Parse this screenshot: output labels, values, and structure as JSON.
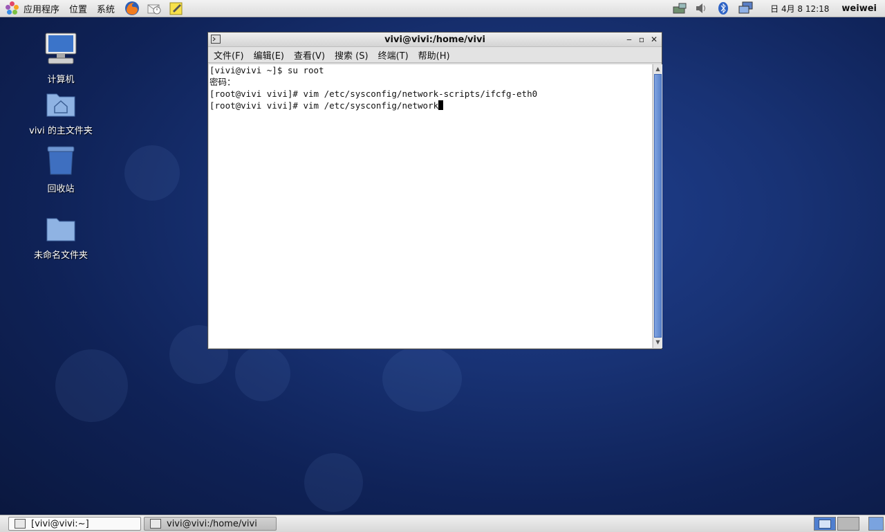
{
  "top_panel": {
    "menus": [
      "应用程序",
      "位置",
      "系统"
    ],
    "launchers": [
      "firefox-icon",
      "mail-icon",
      "notes-icon"
    ],
    "tray_icons": [
      "network-icon",
      "volume-icon",
      "bluetooth-icon",
      "display-icon"
    ],
    "clock": "日 4月  8 12:18",
    "user": "weiwei"
  },
  "desktop": {
    "icons": [
      {
        "label": "计算机",
        "icon": "computer-icon"
      },
      {
        "label": "vivi 的主文件夹",
        "icon": "home-folder-icon"
      },
      {
        "label": "回收站",
        "icon": "trash-icon"
      },
      {
        "label": "未命名文件夹",
        "icon": "folder-icon"
      }
    ]
  },
  "terminal": {
    "title": "vivi@vivi:/home/vivi",
    "menu": [
      "文件(F)",
      "编辑(E)",
      "查看(V)",
      "搜索 (S)",
      "终端(T)",
      "帮助(H)"
    ],
    "lines": [
      "[vivi@vivi ~]$ su root",
      "密码：",
      "[root@vivi vivi]# vim /etc/sysconfig/network-scripts/ifcfg-eth0",
      "[root@vivi vivi]# vim /etc/sysconfig/network"
    ]
  },
  "taskbar": {
    "tasks": [
      "[vivi@vivi:~]",
      "vivi@vivi:/home/vivi"
    ]
  },
  "colors": {
    "desktop_bg": "#183274",
    "scroll_thumb": "#5b84cd"
  }
}
